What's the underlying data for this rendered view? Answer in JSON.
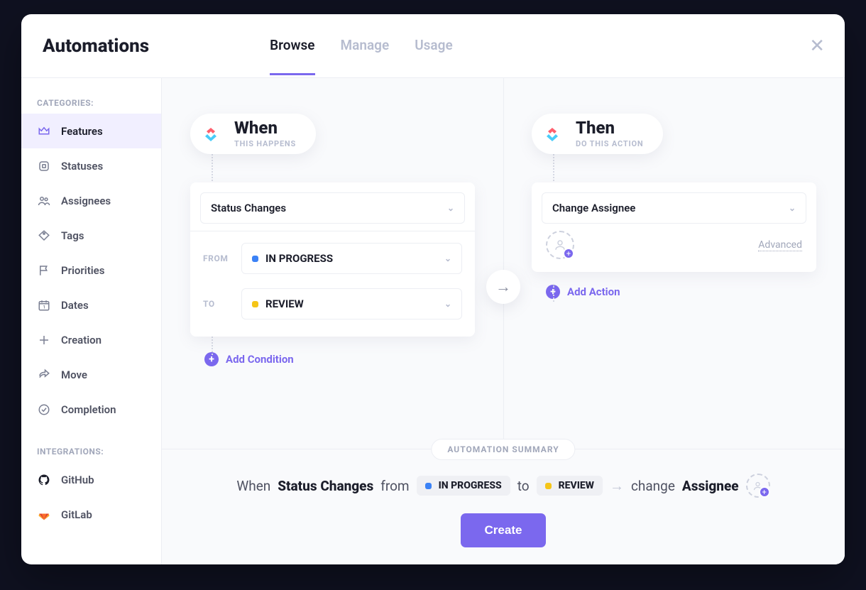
{
  "header": {
    "title": "Automations",
    "tabs": [
      "Browse",
      "Manage",
      "Usage"
    ],
    "active_tab": 0
  },
  "sidebar": {
    "categories_heading": "CATEGORIES:",
    "integrations_heading": "INTEGRATIONS:",
    "categories": [
      {
        "label": "Features",
        "icon": "crown-icon",
        "active": true
      },
      {
        "label": "Statuses",
        "icon": "square-icon"
      },
      {
        "label": "Assignees",
        "icon": "people-icon"
      },
      {
        "label": "Tags",
        "icon": "tag-icon"
      },
      {
        "label": "Priorities",
        "icon": "flag-icon"
      },
      {
        "label": "Dates",
        "icon": "calendar-icon"
      },
      {
        "label": "Creation",
        "icon": "plus-square-icon"
      },
      {
        "label": "Move",
        "icon": "share-icon"
      },
      {
        "label": "Completion",
        "icon": "check-circle-icon"
      }
    ],
    "integrations": [
      {
        "label": "GitHub",
        "icon": "github-icon"
      },
      {
        "label": "GitLab",
        "icon": "gitlab-icon"
      }
    ]
  },
  "when": {
    "title": "When",
    "subtitle": "THIS HAPPENS",
    "trigger_label": "Status Changes",
    "from_label": "FROM",
    "to_label": "TO",
    "from_status": "IN PROGRESS",
    "from_color": "#3b82f6",
    "to_status": "REVIEW",
    "to_color": "#f5c518",
    "add_condition": "Add Condition"
  },
  "then": {
    "title": "Then",
    "subtitle": "DO THIS ACTION",
    "action_label": "Change Assignee",
    "advanced_label": "Advanced",
    "add_action": "Add Action"
  },
  "summary": {
    "heading": "AUTOMATION SUMMARY",
    "when_word": "When",
    "from_word": "from",
    "to_word": "to",
    "change_word": "change",
    "assignee_word": "Assignee",
    "create_button": "Create"
  }
}
